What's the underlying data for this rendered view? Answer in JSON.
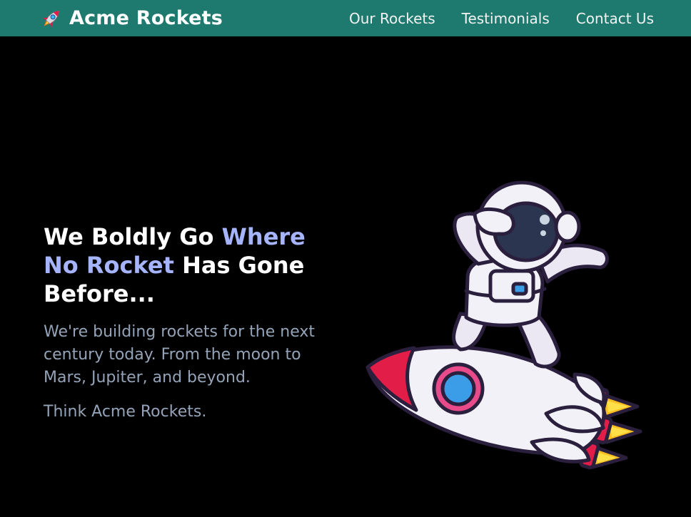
{
  "brand": {
    "icon": "rocket-icon",
    "name": "Acme Rockets"
  },
  "nav": {
    "items": [
      {
        "label": "Our Rockets"
      },
      {
        "label": "Testimonials"
      },
      {
        "label": "Contact Us"
      }
    ]
  },
  "hero": {
    "title_part1": "We Boldly Go ",
    "title_accent": "Where No Rocket",
    "title_part2": " Has Gone Before...",
    "paragraph": "We're building rockets for the next century today. From the moon to Mars, Jupiter, and beyond.",
    "tagline": "Think Acme Rockets.",
    "image": "astronaut-on-rocket-illustration"
  },
  "colors": {
    "navbar": "#1e7a6e",
    "background": "#000000",
    "accent": "#a5b4fc",
    "muted_text": "#94a3b8"
  }
}
